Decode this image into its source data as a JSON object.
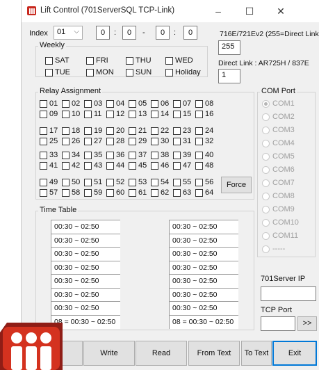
{
  "window": {
    "title": "Lift Control  (701ServerSQL TCP-Link)"
  },
  "titlebar_controls": {
    "minimize": "–",
    "maximize": "☐",
    "close": "✕"
  },
  "index": {
    "label": "Index",
    "selected": "01",
    "spin1": "0",
    "spin2": "0",
    "spin3": "0",
    "spin4": "0",
    "sep_colon": ":",
    "sep_dash": "-"
  },
  "weekly": {
    "title": "Weekly",
    "days": [
      "SAT",
      "FRI",
      "THU",
      "WED",
      "TUE",
      "MON",
      "SUN",
      "Holiday"
    ]
  },
  "device": {
    "label": "716E/721Ev2 (255=Direct Link)",
    "value": "255",
    "direct_label": "Direct Link : AR725H / 837E",
    "direct_value": "1"
  },
  "relay": {
    "title": "Relay Assignment",
    "items": [
      "01",
      "02",
      "03",
      "04",
      "05",
      "06",
      "07",
      "08",
      "09",
      "10",
      "11",
      "12",
      "13",
      "14",
      "15",
      "16",
      "17",
      "18",
      "19",
      "20",
      "21",
      "22",
      "23",
      "24",
      "25",
      "26",
      "27",
      "28",
      "29",
      "30",
      "31",
      "32",
      "33",
      "34",
      "35",
      "36",
      "37",
      "38",
      "39",
      "40",
      "41",
      "42",
      "43",
      "44",
      "45",
      "46",
      "47",
      "48",
      "49",
      "50",
      "51",
      "52",
      "53",
      "54",
      "55",
      "56",
      "57",
      "58",
      "59",
      "60",
      "61",
      "62",
      "63",
      "64"
    ],
    "force_label": "Force"
  },
  "com_port": {
    "title": "COM Port",
    "options": [
      "COM1",
      "COM2",
      "COM3",
      "COM4",
      "COM5",
      "COM6",
      "COM7",
      "COM8",
      "COM9",
      "COM10",
      "COM11",
      "-----"
    ],
    "selected": "COM1"
  },
  "timetable": {
    "title": "Time Table",
    "left": [
      "00:30 ~ 02:50",
      "00:30 ~ 02:50",
      "00:30 ~ 02:50",
      "00:30 ~ 02:50",
      "00:30 ~ 02:50",
      "00:30 ~ 02:50",
      "00:30 ~ 02:50",
      "08 = 00:30 ~ 02:50"
    ],
    "right": [
      "00:30 ~ 02:50",
      "00:30 ~ 02:50",
      "00:30 ~ 02:50",
      "00:30 ~ 02:50",
      "00:30 ~ 02:50",
      "00:30 ~ 02:50",
      "00:30 ~ 02:50",
      "08 = 00:30 ~ 02:50"
    ]
  },
  "server": {
    "ip_label": "701Server IP",
    "ip_value": "",
    "tcp_label": "TCP Port",
    "tcp_value": "",
    "browse": ">>"
  },
  "buttons": {
    "write": "Write",
    "read": "Read",
    "from_text": "From Text",
    "to_text": "To Text",
    "exit": "Exit"
  },
  "colors": {
    "accent": "#0078d7",
    "brand": "#c8281e",
    "window_bg": "#f0f0f0"
  }
}
